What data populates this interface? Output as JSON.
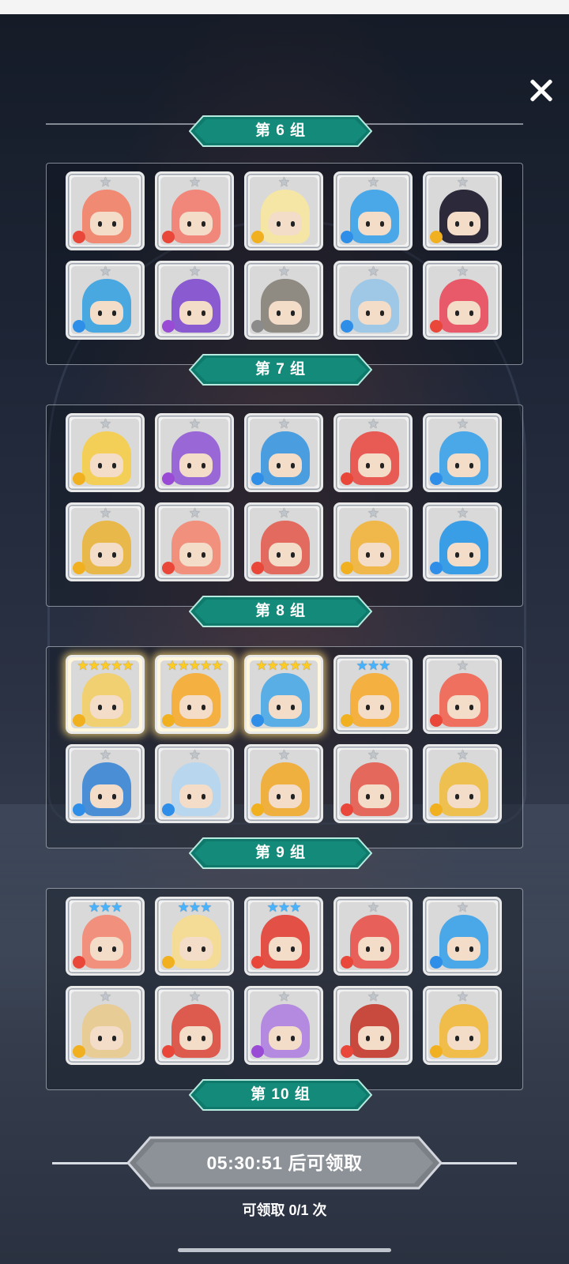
{
  "close_label": "✕",
  "group_labels": [
    "第 6 组",
    "第 7 组",
    "第 8 组",
    "第 9 组",
    "第 10 组"
  ],
  "claim_button": {
    "text": "05:30:51 后可领取"
  },
  "claim_count": "可领取 0/1 次",
  "colors": {
    "label_teal": "#0f7a6c",
    "element_fire": "#e8473a",
    "element_water": "#2f8fe8",
    "element_wind": "#f0b020",
    "element_dark": "#9a4bd6",
    "element_light": "#8b8b8b"
  },
  "groups": [
    {
      "name": "第 6 组",
      "heroes": [
        {
          "icon": "pumpkin-mummy",
          "stars": "★",
          "star_color": "silver",
          "element": "fire",
          "color": "#f08a72"
        },
        {
          "icon": "pink-worm",
          "stars": "★",
          "star_color": "silver",
          "element": "fire",
          "color": "#f0877a"
        },
        {
          "icon": "yellow-ghost",
          "stars": "★",
          "star_color": "silver",
          "element": "wind",
          "color": "#f5e6a6"
        },
        {
          "icon": "blue-bear",
          "stars": "★",
          "star_color": "silver",
          "element": "water",
          "color": "#4aa8e8"
        },
        {
          "icon": "black-haired-girl",
          "stars": "★",
          "star_color": "silver",
          "element": "wind",
          "color": "#2c2a3a"
        },
        {
          "icon": "blue-witch",
          "stars": "★",
          "star_color": "silver",
          "element": "water",
          "color": "#4aa8e0"
        },
        {
          "icon": "purple-witch",
          "stars": "★",
          "star_color": "silver",
          "element": "dark",
          "color": "#8a5ad0"
        },
        {
          "icon": "stone-golem",
          "stars": "★",
          "star_color": "silver",
          "element": "light",
          "color": "#8f8a82"
        },
        {
          "icon": "blue-knight",
          "stars": "★",
          "star_color": "silver",
          "element": "water",
          "color": "#9ec8e6"
        },
        {
          "icon": "red-octopus",
          "stars": "★",
          "star_color": "silver",
          "element": "fire",
          "color": "#e85a6a"
        }
      ]
    },
    {
      "name": "第 7 组",
      "heroes": [
        {
          "icon": "yellow-spiky",
          "stars": "★",
          "star_color": "silver",
          "element": "wind",
          "color": "#f4cf58"
        },
        {
          "icon": "purple-mummy",
          "stars": "★",
          "star_color": "silver",
          "element": "dark",
          "color": "#9a68d6"
        },
        {
          "icon": "blue-tree",
          "stars": "★",
          "star_color": "silver",
          "element": "water",
          "color": "#4a9ee0"
        },
        {
          "icon": "red-bear",
          "stars": "★",
          "star_color": "silver",
          "element": "fire",
          "color": "#e85a54"
        },
        {
          "icon": "blue-bear",
          "stars": "★",
          "star_color": "silver",
          "element": "water",
          "color": "#4aa8e8"
        },
        {
          "icon": "yellow-witch",
          "stars": "★",
          "star_color": "silver",
          "element": "wind",
          "color": "#e8b84a"
        },
        {
          "icon": "pink-girl",
          "stars": "★",
          "star_color": "silver",
          "element": "fire",
          "color": "#f2907e"
        },
        {
          "icon": "red-knight",
          "stars": "★",
          "star_color": "silver",
          "element": "fire",
          "color": "#e26a5e"
        },
        {
          "icon": "yellow-knight",
          "stars": "★",
          "star_color": "silver",
          "element": "wind",
          "color": "#f0b84a"
        },
        {
          "icon": "blue-robot",
          "stars": "★",
          "star_color": "silver",
          "element": "water",
          "color": "#3a9ee6"
        }
      ]
    },
    {
      "name": "第 8 组",
      "heroes": [
        {
          "icon": "blonde-hero",
          "stars": "★★★★★",
          "star_color": "gold",
          "element": "wind",
          "color": "#f0d070",
          "gold": true
        },
        {
          "icon": "orange-sun",
          "stars": "★★★★★",
          "star_color": "gold",
          "element": "wind",
          "color": "#f4b040",
          "gold": true
        },
        {
          "icon": "blue-clock",
          "stars": "★★★★★",
          "star_color": "gold",
          "element": "water",
          "color": "#5aaee6",
          "gold": true
        },
        {
          "icon": "orange-sun",
          "stars": "★★★",
          "star_color": "blue",
          "element": "wind",
          "color": "#f4b040"
        },
        {
          "icon": "red-ribbon-girl",
          "stars": "★",
          "star_color": "silver",
          "element": "fire",
          "color": "#f07060"
        },
        {
          "icon": "blue-skull",
          "stars": "★",
          "star_color": "silver",
          "element": "water",
          "color": "#4a8fd6"
        },
        {
          "icon": "polka-dot-shell",
          "stars": "★",
          "star_color": "silver",
          "element": "water",
          "color": "#b8d6ee"
        },
        {
          "icon": "crown-block",
          "stars": "★",
          "star_color": "silver",
          "element": "wind",
          "color": "#f0b040"
        },
        {
          "icon": "red-armor",
          "stars": "★",
          "star_color": "silver",
          "element": "fire",
          "color": "#e4685c"
        },
        {
          "icon": "gold-armor",
          "stars": "★",
          "star_color": "silver",
          "element": "wind",
          "color": "#eec050"
        }
      ]
    },
    {
      "name": "第 9 组",
      "heroes": [
        {
          "icon": "pink-horned-girl",
          "stars": "★★★",
          "star_color": "blue",
          "element": "fire",
          "color": "#f2907e"
        },
        {
          "icon": "chef-winking",
          "stars": "★★★",
          "star_color": "blue",
          "element": "wind",
          "color": "#f4dc96"
        },
        {
          "icon": "red-tiki",
          "stars": "★★★",
          "star_color": "blue",
          "element": "fire",
          "color": "#e25046"
        },
        {
          "icon": "red-skull",
          "stars": "★",
          "star_color": "silver",
          "element": "fire",
          "color": "#e8605a"
        },
        {
          "icon": "blue-bear",
          "stars": "★",
          "star_color": "silver",
          "element": "water",
          "color": "#4aa8e8"
        },
        {
          "icon": "sand-shell",
          "stars": "★",
          "star_color": "silver",
          "element": "wind",
          "color": "#e8cc96"
        },
        {
          "icon": "red-witch",
          "stars": "★",
          "star_color": "silver",
          "element": "fire",
          "color": "#dc5a4e"
        },
        {
          "icon": "lilac-girl",
          "stars": "★",
          "star_color": "silver",
          "element": "dark",
          "color": "#b48ae0"
        },
        {
          "icon": "red-totem",
          "stars": "★",
          "star_color": "silver",
          "element": "fire",
          "color": "#c84a3e"
        },
        {
          "icon": "gold-lion",
          "stars": "★",
          "star_color": "silver",
          "element": "wind",
          "color": "#f0bc4a"
        }
      ]
    }
  ]
}
